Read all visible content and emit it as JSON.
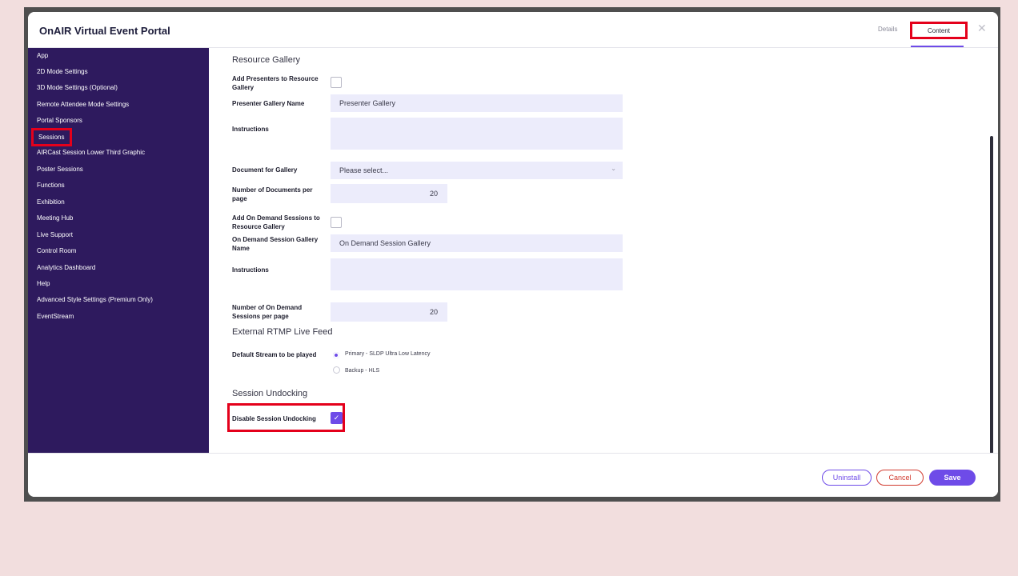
{
  "header": {
    "title": "OnAIR Virtual Event Portal",
    "tabs": {
      "details": "Details",
      "content": "Content"
    },
    "close_glyph": "✕"
  },
  "sidebar": {
    "items": [
      {
        "label": "App"
      },
      {
        "label": "2D Mode Settings"
      },
      {
        "label": "3D Mode Settings (Optional)"
      },
      {
        "label": "Remote Attendee Mode Settings"
      },
      {
        "label": "Portal Sponsors"
      },
      {
        "label": "Sessions"
      },
      {
        "label": "AIRCast Session Lower Third Graphic"
      },
      {
        "label": "Poster Sessions"
      },
      {
        "label": "Functions"
      },
      {
        "label": "Exhibition"
      },
      {
        "label": "Meeting Hub"
      },
      {
        "label": "Live Support"
      },
      {
        "label": "Control Room"
      },
      {
        "label": "Analytics Dashboard"
      },
      {
        "label": "Help"
      },
      {
        "label": "Advanced Style Settings (Premium Only)"
      },
      {
        "label": "EventStream"
      }
    ],
    "selected": "Sessions"
  },
  "form": {
    "resource_gallery": {
      "heading": "Resource Gallery",
      "add_presenters_label": "Add Presenters to Resource Gallery",
      "add_presenters_checked": false,
      "presenter_gallery_name_label": "Presenter Gallery Name",
      "presenter_gallery_name_value": "Presenter Gallery",
      "instructions_label": "Instructions",
      "instructions_value": "",
      "document_label": "Document for Gallery",
      "document_value": "Please select...",
      "docs_per_page_label": "Number of Documents per page",
      "docs_per_page_value": "20",
      "add_on_demand_label": "Add On Demand Sessions to Resource Gallery",
      "add_on_demand_checked": false,
      "on_demand_name_label": "On Demand Session Gallery Name",
      "on_demand_name_value": "On Demand Session Gallery",
      "instructions2_label": "Instructions",
      "instructions2_value": "",
      "on_demand_per_page_label": "Number of On Demand Sessions per page",
      "on_demand_per_page_value": "20"
    },
    "rtmp": {
      "heading": "External RTMP Live Feed",
      "default_stream_label": "Default Stream to be played",
      "options": [
        "Primary - SLDP Ultra Low Latency",
        "Backup - HLS"
      ],
      "selected": "Primary - SLDP Ultra Low Latency"
    },
    "undocking": {
      "heading": "Session Undocking",
      "disable_label": "Disable Session Undocking",
      "disable_checked": true,
      "checkmark": "✓"
    }
  },
  "footer": {
    "uninstall_label": "Uninstall",
    "cancel_label": "Cancel",
    "save_label": "Save"
  },
  "colors": {
    "sidebar_bg": "#2e1a5e",
    "accent": "#6e4be8",
    "highlight": "#e4001b",
    "cancel": "#d13a2e",
    "page_bg": "#f2dede"
  }
}
